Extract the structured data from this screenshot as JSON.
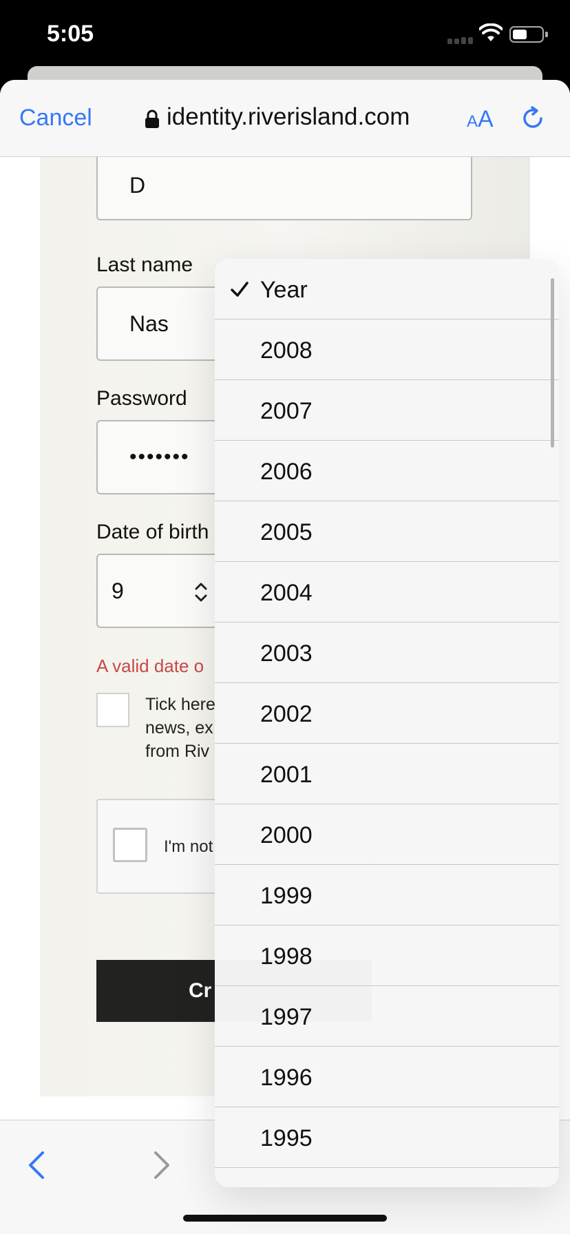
{
  "status_bar": {
    "time": "5:05"
  },
  "browser": {
    "cancel_label": "Cancel",
    "url": "identity.riverisland.com",
    "text_size_small": "A",
    "text_size_large": "A"
  },
  "form": {
    "first_name_value": "D",
    "last_name_label": "Last name",
    "last_name_value": "Nas",
    "password_label": "Password",
    "password_value": "•••••••",
    "dob_label": "Date of birth",
    "dob_day_value": "9",
    "dob_error_visible": "A valid date o",
    "marketing_text_line1": "Tick here",
    "marketing_text_line2": "news, ex",
    "marketing_text_line3": "from Riv",
    "captcha_label": "I'm not",
    "create_button_label": "Cr"
  },
  "year_picker": {
    "selected_label": "Year",
    "years": [
      "2008",
      "2007",
      "2006",
      "2005",
      "2004",
      "2003",
      "2002",
      "2001",
      "2000",
      "1999",
      "1998",
      "1997",
      "1996",
      "1995"
    ]
  }
}
